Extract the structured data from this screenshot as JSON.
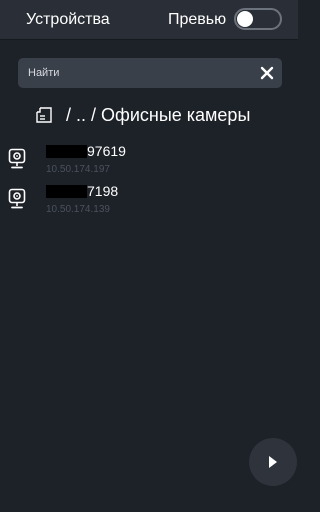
{
  "header": {
    "title": "Устройства",
    "preview_label": "Превью",
    "preview_enabled": false
  },
  "search": {
    "placeholder": "Найти",
    "value": ""
  },
  "breadcrumb": {
    "path": "/ .. / Офисные камеры",
    "icon": "folder-list-icon"
  },
  "devices": [
    {
      "name_suffix": "97619",
      "ip": "10.50.174.197",
      "icon": "camera-icon"
    },
    {
      "name_suffix": "7198",
      "ip": "10.50.174.139",
      "icon": "camera-icon"
    }
  ],
  "colors": {
    "background": "#1d2128",
    "header": "#2a2f37",
    "search": "#3a404a",
    "muted_text": "#4b525c"
  }
}
